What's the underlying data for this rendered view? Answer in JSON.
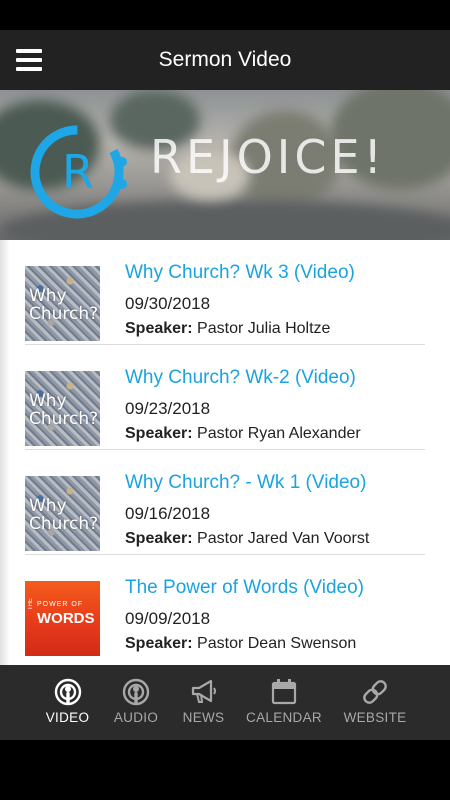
{
  "header": {
    "title": "Sermon Video"
  },
  "banner": {
    "logo_letter": "R",
    "word": "REJOICE!",
    "accent": "#1ea6e6"
  },
  "sermons": [
    {
      "title": "Why Church? Wk 3 (Video)",
      "date": "09/30/2018",
      "speaker_label": "Speaker:",
      "speaker": "Pastor Julia Holtze",
      "thumb": "why-church",
      "thumb_line1": "Why",
      "thumb_line2": "Church?"
    },
    {
      "title": "Why Church? Wk-2 (Video)",
      "date": "09/23/2018",
      "speaker_label": "Speaker:",
      "speaker": "Pastor Ryan Alexander",
      "thumb": "why-church",
      "thumb_line1": "Why",
      "thumb_line2": "Church?"
    },
    {
      "title": "Why Church? - Wk 1 (Video)",
      "date": "09/16/2018",
      "speaker_label": "Speaker:",
      "speaker": "Pastor Jared Van Voorst",
      "thumb": "why-church",
      "thumb_line1": "Why",
      "thumb_line2": "Church?"
    },
    {
      "title": "The Power of Words (Video)",
      "date": "09/09/2018",
      "speaker_label": "Speaker:",
      "speaker": "Pastor Dean Swenson",
      "thumb": "power-of-words",
      "thumb_side": "THE",
      "thumb_line1": "POWER OF",
      "thumb_line2": "WORDS"
    }
  ],
  "tabs": [
    {
      "label": "VIDEO",
      "icon": "podcast-icon",
      "active": true
    },
    {
      "label": "AUDIO",
      "icon": "podcast-icon",
      "active": false
    },
    {
      "label": "NEWS",
      "icon": "megaphone-icon",
      "active": false
    },
    {
      "label": "CALENDAR",
      "icon": "calendar-icon",
      "active": false
    },
    {
      "label": "WEBSITE",
      "icon": "link-icon",
      "active": false
    }
  ],
  "colors": {
    "accent": "#19a3e0",
    "app_bar": "#222222",
    "tab_bar": "#2b2b2b",
    "orange_thumb": "#e83b1a"
  }
}
